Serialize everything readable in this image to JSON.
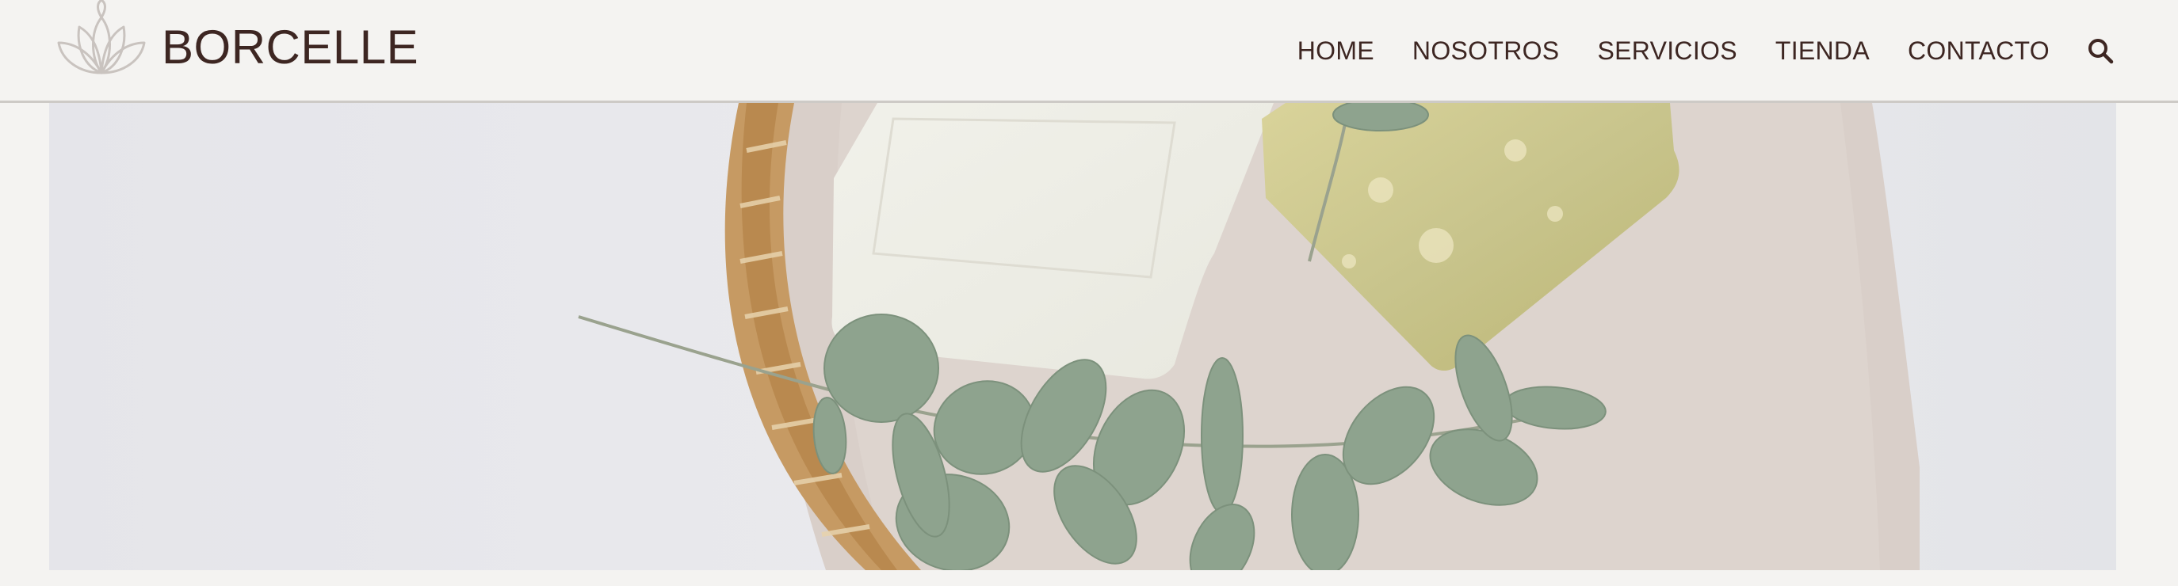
{
  "brand": {
    "name": "BORCELLE",
    "logo_icon": "lotus-icon"
  },
  "nav": {
    "items": [
      {
        "label": "HOME"
      },
      {
        "label": "NOSOTROS"
      },
      {
        "label": "SERVICIOS"
      },
      {
        "label": "TIENDA"
      },
      {
        "label": "CONTACTO"
      }
    ],
    "search_icon": "search-icon"
  },
  "colors": {
    "background": "#f4f3f1",
    "text": "#3d2622",
    "logo": "#c9c3bf"
  },
  "hero": {
    "image": "soap-bars-eucalyptus-basket-photo"
  }
}
